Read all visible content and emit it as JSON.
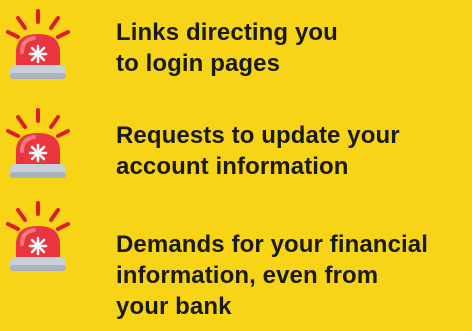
{
  "colors": {
    "background": "#f8d417",
    "text": "#1a1a1a",
    "siren_dome": "#e8353f",
    "siren_base": "#c8d0d8",
    "siren_rays": "#e01b2a"
  },
  "alerts": [
    {
      "icon": "siren-alarm-icon",
      "lines": [
        "Links directing you",
        "to login pages"
      ]
    },
    {
      "icon": "siren-alarm-icon",
      "lines": [
        "Requests to update your",
        "account information"
      ]
    },
    {
      "icon": "siren-alarm-icon",
      "lines": [
        "Demands for your financial",
        "information, even from",
        "your bank"
      ]
    }
  ]
}
